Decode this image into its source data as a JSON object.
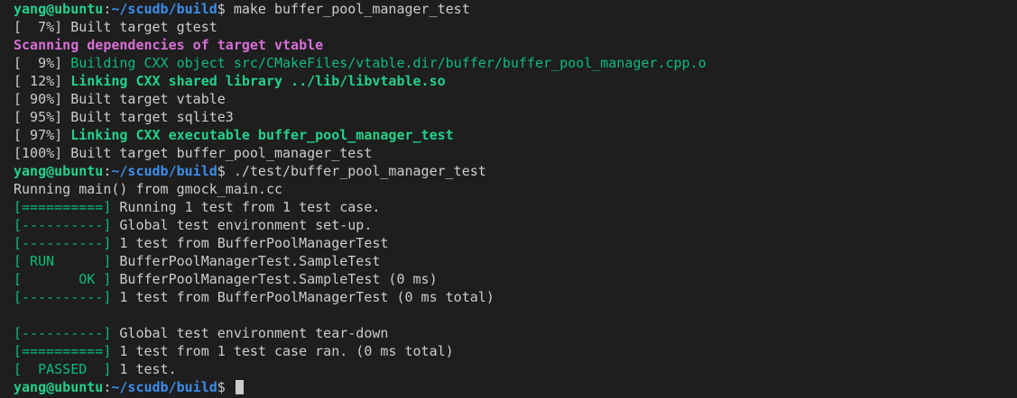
{
  "terminal": {
    "lines": [
      [
        {
          "t": "yang@ubuntu",
          "c": "prompt-user"
        },
        {
          "t": ":",
          "c": "default"
        },
        {
          "t": "~/scudb/build",
          "c": "prompt-path"
        },
        {
          "t": "$ make buffer_pool_manager_test",
          "c": "default"
        }
      ],
      [
        {
          "t": "[  7%] Built target gtest",
          "c": "default"
        }
      ],
      [
        {
          "t": "Scanning dependencies of target vtable",
          "c": "magenta-bold"
        }
      ],
      [
        {
          "t": "[  9%] ",
          "c": "default"
        },
        {
          "t": "Building CXX object src/CMakeFiles/vtable.dir/buffer/buffer_pool_manager.cpp.o",
          "c": "green"
        }
      ],
      [
        {
          "t": "[ 12%] ",
          "c": "default"
        },
        {
          "t": "Linking CXX shared library ../lib/libvtable.so",
          "c": "green-bold"
        }
      ],
      [
        {
          "t": "[ 90%] Built target vtable",
          "c": "default"
        }
      ],
      [
        {
          "t": "[ 95%] Built target sqlite3",
          "c": "default"
        }
      ],
      [
        {
          "t": "[ 97%] ",
          "c": "default"
        },
        {
          "t": "Linking CXX executable buffer_pool_manager_test",
          "c": "green-bold"
        }
      ],
      [
        {
          "t": "[100%] Built target buffer_pool_manager_test",
          "c": "default"
        }
      ],
      [
        {
          "t": "yang@ubuntu",
          "c": "prompt-user"
        },
        {
          "t": ":",
          "c": "default"
        },
        {
          "t": "~/scudb/build",
          "c": "prompt-path"
        },
        {
          "t": "$ ./test/buffer_pool_manager_test",
          "c": "default"
        }
      ],
      [
        {
          "t": "Running main() from gmock_main.cc",
          "c": "default"
        }
      ],
      [
        {
          "t": "[==========]",
          "c": "green"
        },
        {
          "t": " Running 1 test from 1 test case.",
          "c": "default"
        }
      ],
      [
        {
          "t": "[----------]",
          "c": "green"
        },
        {
          "t": " Global test environment set-up.",
          "c": "default"
        }
      ],
      [
        {
          "t": "[----------]",
          "c": "green"
        },
        {
          "t": " 1 test from BufferPoolManagerTest",
          "c": "default"
        }
      ],
      [
        {
          "t": "[ RUN      ]",
          "c": "green"
        },
        {
          "t": " BufferPoolManagerTest.SampleTest",
          "c": "default"
        }
      ],
      [
        {
          "t": "[       OK ]",
          "c": "green"
        },
        {
          "t": " BufferPoolManagerTest.SampleTest (0 ms)",
          "c": "default"
        }
      ],
      [
        {
          "t": "[----------]",
          "c": "green"
        },
        {
          "t": " 1 test from BufferPoolManagerTest (0 ms total)",
          "c": "default"
        }
      ],
      [],
      [
        {
          "t": "[----------]",
          "c": "green"
        },
        {
          "t": " Global test environment tear-down",
          "c": "default"
        }
      ],
      [
        {
          "t": "[==========]",
          "c": "green"
        },
        {
          "t": " 1 test from 1 test case ran. (0 ms total)",
          "c": "default"
        }
      ],
      [
        {
          "t": "[  PASSED  ]",
          "c": "green"
        },
        {
          "t": " 1 test.",
          "c": "default"
        }
      ],
      [
        {
          "t": "yang@ubuntu",
          "c": "prompt-user"
        },
        {
          "t": ":",
          "c": "default"
        },
        {
          "t": "~/scudb/build",
          "c": "prompt-path"
        },
        {
          "t": "$ ",
          "c": "default"
        }
      ]
    ],
    "cursor_on_last_line": true
  },
  "colors": {
    "background": "#1e1e1e",
    "default_text": "#cccccc",
    "prompt_user": "#23d18b",
    "prompt_path": "#3b8eea",
    "magenta_bold": "#d670d6",
    "green": "#0dbc79",
    "green_bold": "#23d18b"
  }
}
